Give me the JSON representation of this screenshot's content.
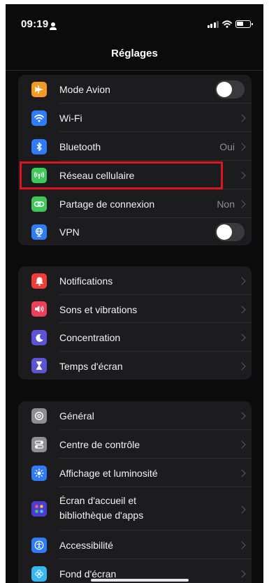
{
  "status_bar": {
    "time": "09:19"
  },
  "nav": {
    "title": "Réglages"
  },
  "groups": [
    {
      "rows": [
        {
          "label": "Mode Avion",
          "icon": "airplane-icon",
          "icon_color": "#f59a23",
          "accessory": "toggle",
          "toggle_on": false
        },
        {
          "label": "Wi-Fi",
          "icon": "wifi-icon",
          "icon_color": "#2f7cf6",
          "accessory": "chevron"
        },
        {
          "label": "Bluetooth",
          "icon": "bluetooth-icon",
          "icon_color": "#2f7cf6",
          "value": "Oui",
          "accessory": "chevron"
        },
        {
          "label": "Réseau cellulaire",
          "icon": "antenna-icon",
          "icon_color": "#3ec85a",
          "accessory": "chevron",
          "highlighted": true
        },
        {
          "label": "Partage de connexion",
          "icon": "link-icon",
          "icon_color": "#3ec85a",
          "value": "Non",
          "accessory": "chevron"
        },
        {
          "label": "VPN",
          "icon": "globe-icon",
          "icon_color": "#2f7cf6",
          "accessory": "toggle",
          "toggle_on": false
        }
      ]
    },
    {
      "rows": [
        {
          "label": "Notifications",
          "icon": "bell-icon",
          "icon_color": "#ef3e3a",
          "accessory": "chevron"
        },
        {
          "label": "Sons et vibrations",
          "icon": "speaker-icon",
          "icon_color": "#ef3e58",
          "accessory": "chevron"
        },
        {
          "label": "Concentration",
          "icon": "moon-icon",
          "icon_color": "#5b55d6",
          "accessory": "chevron"
        },
        {
          "label": "Temps d'écran",
          "icon": "hourglass-icon",
          "icon_color": "#5b55d6",
          "accessory": "chevron"
        }
      ]
    },
    {
      "rows": [
        {
          "label": "Général",
          "icon": "gear-icon",
          "icon_color": "#8e8e93",
          "accessory": "chevron"
        },
        {
          "label": "Centre de contrôle",
          "icon": "toggles-icon",
          "icon_color": "#8e8e93",
          "accessory": "chevron"
        },
        {
          "label": "Affichage et luminosité",
          "icon": "sun-icon",
          "icon_color": "#2f7cf6",
          "accessory": "chevron"
        },
        {
          "label": "Écran d'accueil et bibliothèque d'apps",
          "label_line1": "Écran d'accueil et",
          "label_line2": "bibliothèque d'apps",
          "icon": "apps-grid-icon",
          "icon_color": "#4b3ed1",
          "accessory": "chevron"
        },
        {
          "label": "Accessibilité",
          "icon": "accessibility-icon",
          "icon_color": "#2f7cf6",
          "accessory": "chevron"
        },
        {
          "label": "Fond d'écran",
          "icon": "flower-icon",
          "icon_color": "#38b6f0",
          "accessory": "chevron"
        }
      ]
    }
  ]
}
